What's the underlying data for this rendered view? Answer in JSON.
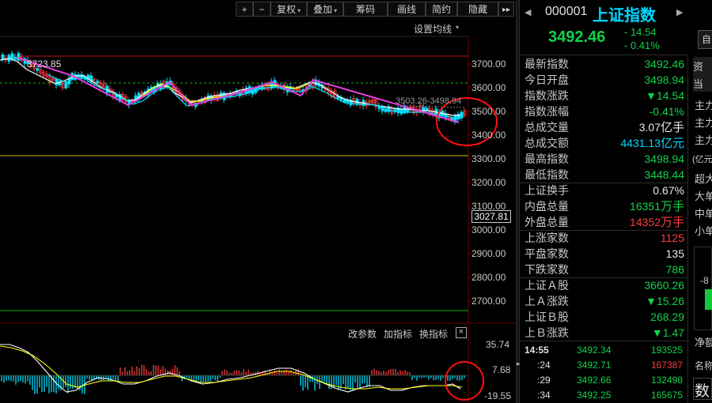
{
  "toolbar": {
    "plus": "+",
    "minus": "−",
    "fuquan": "复权",
    "diejia": "叠加",
    "chouma": "筹码",
    "huaxian": "画线",
    "jianyue": "简约",
    "yincang": "隐藏",
    "more": "▸▸"
  },
  "chart": {
    "setting_ma": "设置均线",
    "high_label": "3723.85",
    "range_label": "3503.26-3498.94",
    "last_price": "3027.81",
    "y_ticks": [
      "3700.00",
      "3600.00",
      "3500.00",
      "3400.00",
      "3300.00",
      "3200.00",
      "3100.00",
      "3000.00",
      "2900.00",
      "2800.00",
      "2700.00"
    ],
    "sub_links": [
      "改参数",
      "加指标",
      "换指标"
    ],
    "close_icon": "×",
    "sub_ticks": [
      "35.74",
      "7.68",
      "-19.55"
    ],
    "colors": {
      "candle_up": "#ff3c3c",
      "candle_down": "#00e0ff",
      "trend": "#e040e0",
      "ma_yellow": "#ffff00",
      "ma_white": "#ffffff",
      "ref_red": "#c02020",
      "ref_yellow": "#d0d000",
      "ref_green": "#00c000",
      "circle": "#ff1010"
    }
  },
  "header": {
    "code": "000001",
    "name": "上证指数",
    "price": "3492.46",
    "change": "- 14.54",
    "change_pct": "- 0.41%",
    "side_btn": "自"
  },
  "stats": [
    {
      "label": "最新指数",
      "value": "3492.46",
      "color": "green"
    },
    {
      "label": "今日开盘",
      "value": "3498.94",
      "color": "green"
    },
    {
      "label": "指数涨跌",
      "value": "▼14.54",
      "color": "green"
    },
    {
      "label": "指数涨幅",
      "value": "-0.41%",
      "color": "green"
    },
    {
      "label": "总成交量",
      "value": "3.07",
      "unit": "亿手",
      "color": "white"
    },
    {
      "label": "总成交额",
      "value": "4431.13",
      "unit": "亿元",
      "color": "cyan"
    },
    {
      "label": "最高指数",
      "value": "3498.94",
      "color": "green"
    },
    {
      "label": "最低指数",
      "value": "3448.44",
      "color": "green"
    },
    {
      "label": "上证换手",
      "value": "0.67%",
      "color": "white"
    },
    {
      "label": "内盘总量",
      "value": "16351",
      "unit": "万手",
      "color": "green"
    },
    {
      "label": "外盘总量",
      "value": "14352",
      "unit": "万手",
      "color": "red"
    },
    {
      "label": "上涨家数",
      "value": "1125",
      "color": "red"
    },
    {
      "label": "平盘家数",
      "value": "135",
      "color": "white"
    },
    {
      "label": "下跌家数",
      "value": "786",
      "color": "green"
    },
    {
      "label": "上证Ａ股",
      "value": "3660.26",
      "color": "green"
    },
    {
      "label": "上Ａ涨跌",
      "value": "▼15.26",
      "color": "green"
    },
    {
      "label": "上证Ｂ股",
      "value": "268.29",
      "color": "green"
    },
    {
      "label": "上Ｂ涨跌",
      "value": "▼1.47",
      "color": "green"
    }
  ],
  "ticks": [
    {
      "time": "14:55",
      "price": "3492.34",
      "vol": "193525"
    },
    {
      "time": ":24",
      "price": "3492.71",
      "vol": "167387"
    },
    {
      "time": ":29",
      "price": "3492.66",
      "vol": "132498"
    },
    {
      "time": ":34",
      "price": "3492.25",
      "vol": "165675"
    }
  ],
  "edge": [
    "资",
    "当",
    "主力",
    "主力",
    "主力",
    "(亿元",
    "超大",
    "大单",
    "中单",
    "小单",
    "-8",
    "净额",
    "名称",
    "数"
  ]
}
